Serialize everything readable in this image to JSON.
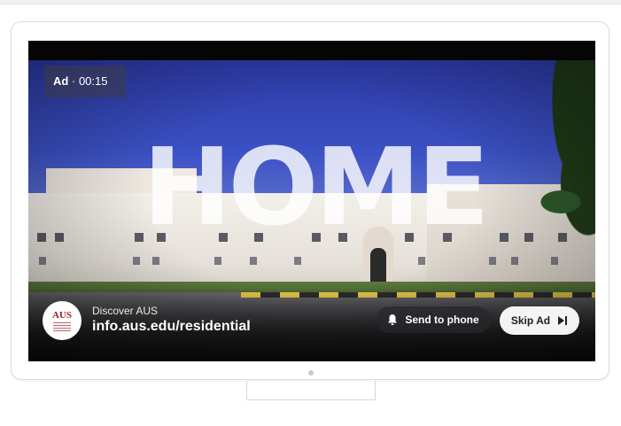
{
  "ad": {
    "badge_label": "Ad",
    "separator": "·",
    "countdown": "00:15"
  },
  "video": {
    "overlay_text": "HOME"
  },
  "advertiser": {
    "logo_text": "AUS",
    "name": "Discover AUS",
    "url": "info.aus.edu/residential"
  },
  "actions": {
    "send_to_phone_label": "Send to phone",
    "skip_ad_label": "Skip Ad",
    "send_icon": "bell-icon",
    "skip_icon": "skip-next-icon"
  },
  "colors": {
    "logo_red": "#9c1f2a",
    "skip_bg": "#f4f4f4"
  }
}
